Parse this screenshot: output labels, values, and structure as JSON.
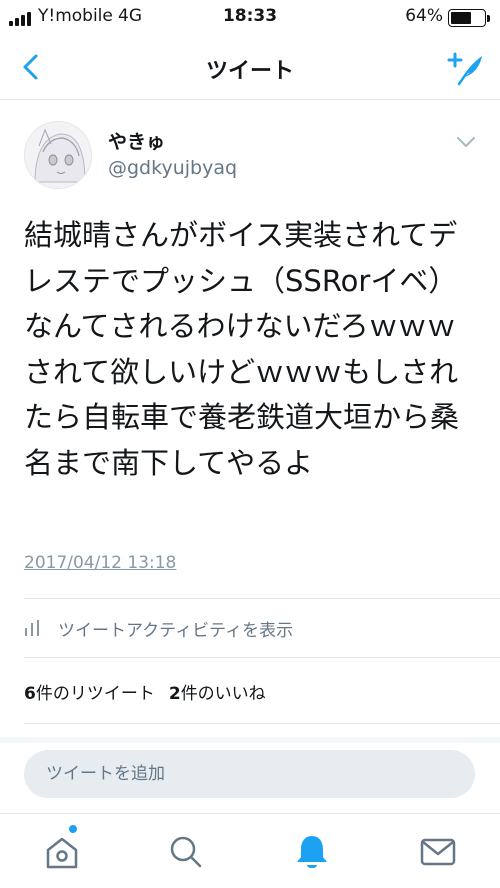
{
  "status_bar": {
    "carrier": "Y!mobile",
    "network": "4G",
    "time": "18:33",
    "battery_percent": "64%",
    "battery_level": 0.64
  },
  "nav": {
    "title": "ツイート",
    "back_icon": "chevron-left-icon",
    "compose_icon": "compose-feather-icon"
  },
  "tweet": {
    "display_name": "やきゅ",
    "handle": "@gdkyujbyaq",
    "text": "結城晴さんがボイス実装されてデレステでプッシュ（SSRorイベ）なんてされるわけないだろｗｗｗされて欲しいけどｗｗｗもしされたら自転車で養老鉄道大垣から桑名まで南下してやるよ",
    "timestamp": "2017/04/12 13:18",
    "activity_label": "ツイートアクティビティを表示",
    "retweet_count": "6",
    "retweet_label": "件のリツイート",
    "like_count": "2",
    "like_label": "件のいいね"
  },
  "reply": {
    "placeholder": "ツイートを追加"
  },
  "tab_bar": {
    "items": [
      "home-icon",
      "search-icon",
      "notifications-icon",
      "messages-icon"
    ],
    "active": "notifications-icon",
    "unread_dot_on": "home-icon"
  },
  "colors": {
    "accent": "#1da1f2",
    "text_primary": "#14171a",
    "text_secondary": "#657786",
    "divider": "#e1e8ed",
    "reply_background": "#e6ecf0"
  }
}
